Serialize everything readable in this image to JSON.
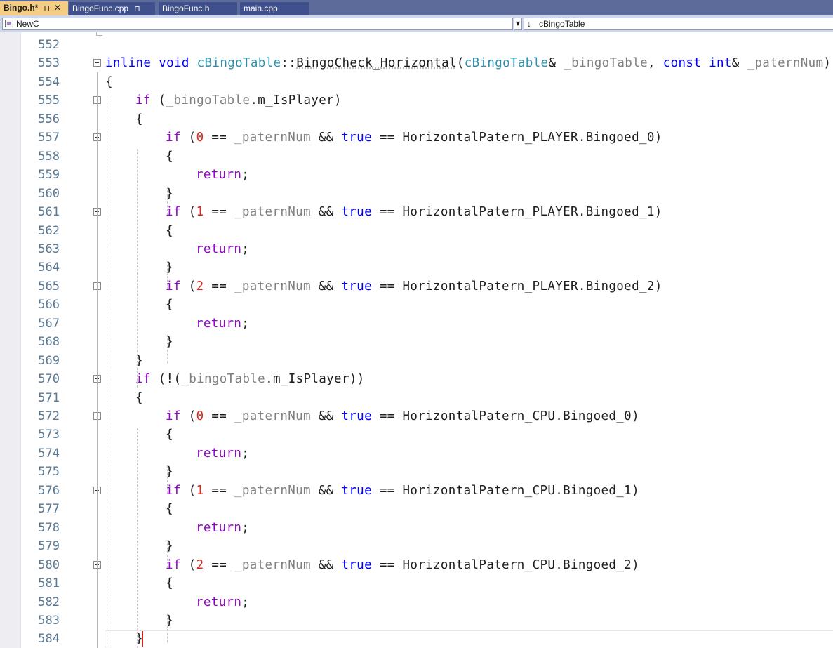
{
  "tabs": [
    {
      "label": "Bingo.h*",
      "active": true,
      "pin": "⊓",
      "close": "✕"
    },
    {
      "label": "BingoFunc.cpp",
      "active": false,
      "pin": "⊓"
    },
    {
      "label": "BingoFunc.h",
      "active": false
    },
    {
      "label": "main.cpp",
      "active": false
    }
  ],
  "nav": {
    "scope": "NewC",
    "member": "cBingoTable",
    "scope_icon": "class-icon",
    "member_icon": "arrow-down-icon"
  },
  "colors": {
    "keyword": "#0000ff",
    "control": "#8f08c4",
    "type": "#2b91af",
    "param": "#808080",
    "number": "#e0281a",
    "tab_active": "#f5cc84",
    "tab_bar": "#5c6b99"
  },
  "code_lines": [
    {
      "n": "552",
      "fold": false,
      "tokens": []
    },
    {
      "n": "553",
      "fold": true,
      "tokens": [
        {
          "t": "inline",
          "c": "kw"
        },
        {
          "t": " "
        },
        {
          "t": "void",
          "c": "kw"
        },
        {
          "t": " "
        },
        {
          "t": "cBingoTable",
          "c": "type"
        },
        {
          "t": "::"
        },
        {
          "t": "BingoCheck_Horizontal",
          "c": "func"
        },
        {
          "t": "("
        },
        {
          "t": "cBingoTable",
          "c": "type"
        },
        {
          "t": "& "
        },
        {
          "t": "_bingoTable",
          "c": "param"
        },
        {
          "t": ", "
        },
        {
          "t": "const",
          "c": "kw"
        },
        {
          "t": " "
        },
        {
          "t": "int",
          "c": "kw"
        },
        {
          "t": "& "
        },
        {
          "t": "_paternNum",
          "c": "param"
        },
        {
          "t": ")"
        }
      ]
    },
    {
      "n": "554",
      "fold": false,
      "indent": 0,
      "tokens": [
        {
          "t": "{"
        }
      ]
    },
    {
      "n": "555",
      "fold": true,
      "indent": 1,
      "tokens": [
        {
          "t": "if",
          "c": "ctl"
        },
        {
          "t": " ("
        },
        {
          "t": "_bingoTable",
          "c": "param"
        },
        {
          "t": ".m_IsPlayer)"
        }
      ]
    },
    {
      "n": "556",
      "fold": false,
      "indent": 1,
      "tokens": [
        {
          "t": "{"
        }
      ]
    },
    {
      "n": "557",
      "fold": true,
      "indent": 2,
      "tokens": [
        {
          "t": "if",
          "c": "ctl"
        },
        {
          "t": " ("
        },
        {
          "t": "0",
          "c": "num"
        },
        {
          "t": " == "
        },
        {
          "t": "_paternNum",
          "c": "param"
        },
        {
          "t": " && "
        },
        {
          "t": "true",
          "c": "kw"
        },
        {
          "t": " == HorizontalPatern_PLAYER.Bingoed_0)"
        }
      ]
    },
    {
      "n": "558",
      "fold": false,
      "indent": 2,
      "tokens": [
        {
          "t": "{"
        }
      ]
    },
    {
      "n": "559",
      "fold": false,
      "indent": 3,
      "tokens": [
        {
          "t": "return",
          "c": "ctl"
        },
        {
          "t": ";"
        }
      ]
    },
    {
      "n": "560",
      "fold": false,
      "indent": 2,
      "tokens": [
        {
          "t": "}"
        }
      ]
    },
    {
      "n": "561",
      "fold": true,
      "indent": 2,
      "tokens": [
        {
          "t": "if",
          "c": "ctl"
        },
        {
          "t": " ("
        },
        {
          "t": "1",
          "c": "num"
        },
        {
          "t": " == "
        },
        {
          "t": "_paternNum",
          "c": "param"
        },
        {
          "t": " && "
        },
        {
          "t": "true",
          "c": "kw"
        },
        {
          "t": " == HorizontalPatern_PLAYER.Bingoed_1)"
        }
      ]
    },
    {
      "n": "562",
      "fold": false,
      "indent": 2,
      "tokens": [
        {
          "t": "{"
        }
      ]
    },
    {
      "n": "563",
      "fold": false,
      "indent": 3,
      "tokens": [
        {
          "t": "return",
          "c": "ctl"
        },
        {
          "t": ";"
        }
      ]
    },
    {
      "n": "564",
      "fold": false,
      "indent": 2,
      "tokens": [
        {
          "t": "}"
        }
      ]
    },
    {
      "n": "565",
      "fold": true,
      "indent": 2,
      "tokens": [
        {
          "t": "if",
          "c": "ctl"
        },
        {
          "t": " ("
        },
        {
          "t": "2",
          "c": "num"
        },
        {
          "t": " == "
        },
        {
          "t": "_paternNum",
          "c": "param"
        },
        {
          "t": " && "
        },
        {
          "t": "true",
          "c": "kw"
        },
        {
          "t": " == HorizontalPatern_PLAYER.Bingoed_2)"
        }
      ]
    },
    {
      "n": "566",
      "fold": false,
      "indent": 2,
      "tokens": [
        {
          "t": "{"
        }
      ]
    },
    {
      "n": "567",
      "fold": false,
      "indent": 3,
      "tokens": [
        {
          "t": "return",
          "c": "ctl"
        },
        {
          "t": ";"
        }
      ]
    },
    {
      "n": "568",
      "fold": false,
      "indent": 2,
      "tokens": [
        {
          "t": "}"
        }
      ]
    },
    {
      "n": "569",
      "fold": false,
      "indent": 1,
      "tokens": [
        {
          "t": "}"
        }
      ]
    },
    {
      "n": "570",
      "fold": true,
      "indent": 1,
      "tokens": [
        {
          "t": "if",
          "c": "ctl"
        },
        {
          "t": " (!("
        },
        {
          "t": "_bingoTable",
          "c": "param"
        },
        {
          "t": ".m_IsPlayer))"
        }
      ]
    },
    {
      "n": "571",
      "fold": false,
      "indent": 1,
      "tokens": [
        {
          "t": "{"
        }
      ]
    },
    {
      "n": "572",
      "fold": true,
      "indent": 2,
      "tokens": [
        {
          "t": "if",
          "c": "ctl"
        },
        {
          "t": " ("
        },
        {
          "t": "0",
          "c": "num"
        },
        {
          "t": " == "
        },
        {
          "t": "_paternNum",
          "c": "param"
        },
        {
          "t": " && "
        },
        {
          "t": "true",
          "c": "kw"
        },
        {
          "t": " == HorizontalPatern_CPU.Bingoed_0)"
        }
      ]
    },
    {
      "n": "573",
      "fold": false,
      "indent": 2,
      "tokens": [
        {
          "t": "{"
        }
      ]
    },
    {
      "n": "574",
      "fold": false,
      "indent": 3,
      "tokens": [
        {
          "t": "return",
          "c": "ctl"
        },
        {
          "t": ";"
        }
      ]
    },
    {
      "n": "575",
      "fold": false,
      "indent": 2,
      "tokens": [
        {
          "t": "}"
        }
      ]
    },
    {
      "n": "576",
      "fold": true,
      "indent": 2,
      "tokens": [
        {
          "t": "if",
          "c": "ctl"
        },
        {
          "t": " ("
        },
        {
          "t": "1",
          "c": "num"
        },
        {
          "t": " == "
        },
        {
          "t": "_paternNum",
          "c": "param"
        },
        {
          "t": " && "
        },
        {
          "t": "true",
          "c": "kw"
        },
        {
          "t": " == HorizontalPatern_CPU.Bingoed_1)"
        }
      ]
    },
    {
      "n": "577",
      "fold": false,
      "indent": 2,
      "tokens": [
        {
          "t": "{"
        }
      ]
    },
    {
      "n": "578",
      "fold": false,
      "indent": 3,
      "tokens": [
        {
          "t": "return",
          "c": "ctl"
        },
        {
          "t": ";"
        }
      ]
    },
    {
      "n": "579",
      "fold": false,
      "indent": 2,
      "tokens": [
        {
          "t": "}"
        }
      ]
    },
    {
      "n": "580",
      "fold": true,
      "indent": 2,
      "tokens": [
        {
          "t": "if",
          "c": "ctl"
        },
        {
          "t": " ("
        },
        {
          "t": "2",
          "c": "num"
        },
        {
          "t": " == "
        },
        {
          "t": "_paternNum",
          "c": "param"
        },
        {
          "t": " && "
        },
        {
          "t": "true",
          "c": "kw"
        },
        {
          "t": " == HorizontalPatern_CPU.Bingoed_2)"
        }
      ]
    },
    {
      "n": "581",
      "fold": false,
      "indent": 2,
      "tokens": [
        {
          "t": "{"
        }
      ]
    },
    {
      "n": "582",
      "fold": false,
      "indent": 3,
      "tokens": [
        {
          "t": "return",
          "c": "ctl"
        },
        {
          "t": ";"
        }
      ]
    },
    {
      "n": "583",
      "fold": false,
      "indent": 2,
      "tokens": [
        {
          "t": "}"
        }
      ]
    },
    {
      "n": "584",
      "fold": false,
      "indent": 1,
      "tokens": [
        {
          "t": "}"
        }
      ]
    }
  ]
}
